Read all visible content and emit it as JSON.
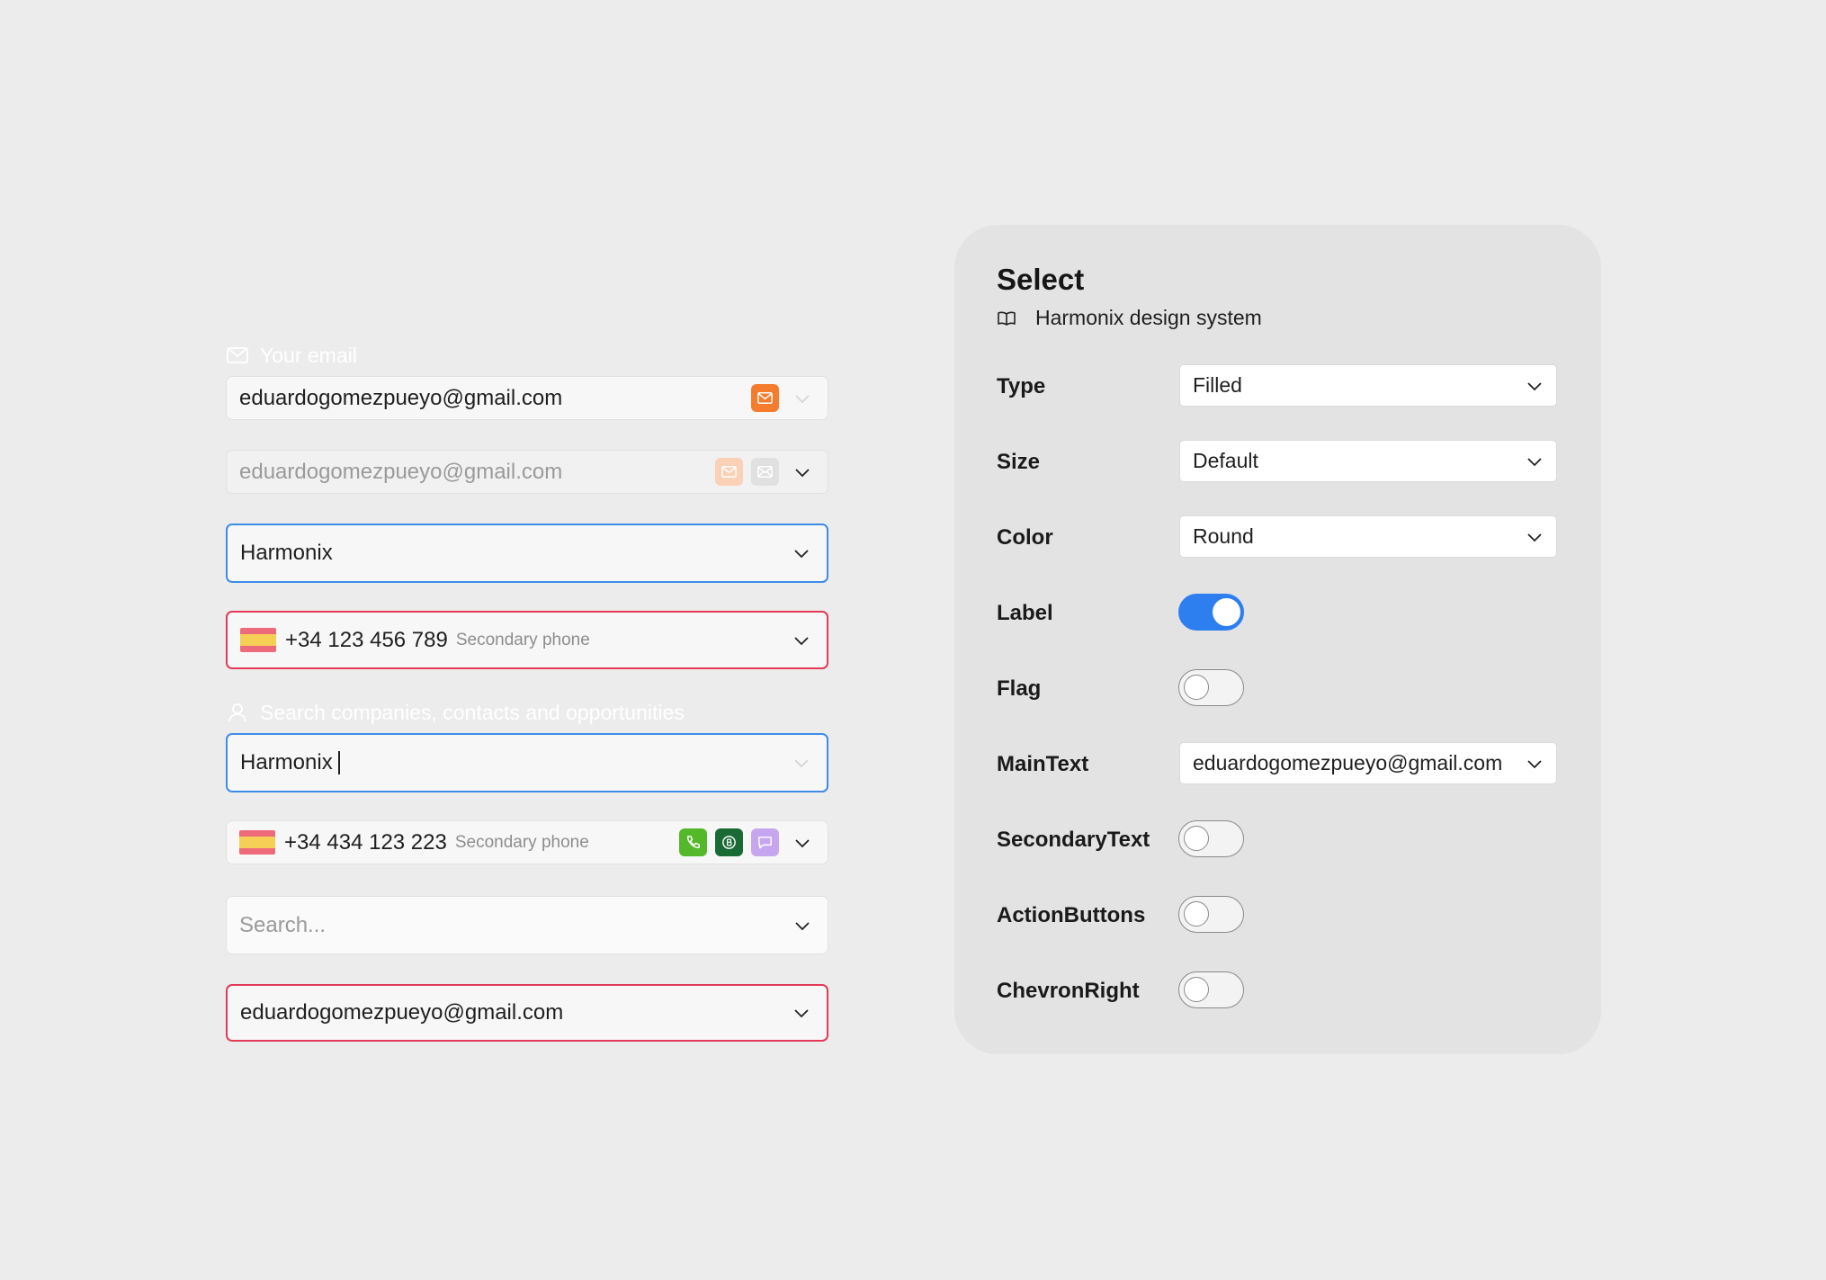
{
  "left": {
    "email_label": "Your email",
    "field_email": "eduardogomezpueyo@gmail.com",
    "field_email_disabled": "eduardogomezpueyo@gmail.com",
    "field_harmonix": "Harmonix",
    "field_phone_error": {
      "main": "+34 123 456 789",
      "secondary": "Secondary phone"
    },
    "search_label": "Search companies, contacts and opportunities",
    "field_typing": "Harmonix",
    "field_phone_actions": {
      "main": "+34 434 123 223",
      "secondary": "Secondary phone"
    },
    "field_search_placeholder": "Search...",
    "field_email_error": "eduardogomezpueyo@gmail.com"
  },
  "icons": {
    "email_label": "mail-icon",
    "search_label": "user-icon",
    "email_action": "mail-icon",
    "email_action_2": "mail-open-icon",
    "phone_action": "phone-icon",
    "whatsapp_action": "whatsapp-icon",
    "message_action": "message-icon",
    "chevron": "chevron-down-icon",
    "flag": "spain-flag-icon",
    "subtitle": "book-icon"
  },
  "colors": {
    "focus_border": "#3e8ce8",
    "error_border": "#e23a57",
    "email_action": "#f47c2c",
    "phone_action": "#54b82a",
    "whatsapp_action": "#1a6a36",
    "message_action": "#c6a6ef",
    "toggle_on": "#2d7ff0"
  },
  "panel": {
    "title": "Select",
    "subtitle": "Harmonix design system",
    "props": {
      "type": {
        "label": "Type",
        "value": "Filled"
      },
      "size": {
        "label": "Size",
        "value": "Default"
      },
      "color": {
        "label": "Color",
        "value": "Round"
      },
      "label": {
        "label": "Label",
        "on": true
      },
      "flag": {
        "label": "Flag",
        "on": false
      },
      "maintext": {
        "label": "MainText",
        "value": "eduardogomezpueyo@gmail.com"
      },
      "secondarytext": {
        "label": "SecondaryText",
        "on": false
      },
      "actionbuttons": {
        "label": "ActionButtons",
        "on": false
      },
      "chevronright": {
        "label": "ChevronRight",
        "on": false
      }
    }
  }
}
